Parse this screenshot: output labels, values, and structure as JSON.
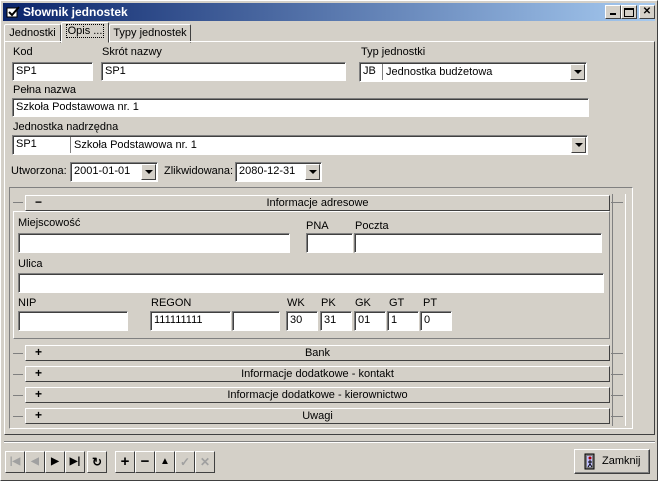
{
  "window": {
    "title": "Słownik jednostek"
  },
  "tabs": [
    {
      "label": "Jednostki",
      "active": false
    },
    {
      "label": "Opis ...",
      "active": true
    },
    {
      "label": "Typy jednostek",
      "active": false
    }
  ],
  "form": {
    "kod_label": "Kod",
    "kod_value": "SP1",
    "skrot_label": "Skrót nazwy",
    "skrot_value": "SP1",
    "typ_label": "Typ jednostki",
    "typ_code": "JB",
    "typ_name": "Jednostka budżetowa",
    "pelna_label": "Pełna nazwa",
    "pelna_value": "Szkoła Podstawowa nr. 1",
    "nadrzedna_label": "Jednostka nadrzędna",
    "nadrzedna_code": "SP1",
    "nadrzedna_name": "Szkoła Podstawowa nr. 1",
    "utworzona_label": "Utworzona:",
    "utworzona_value": "2001-01-01",
    "zlikwidowana_label": "Zlikwidowana:",
    "zlikwidowana_value": "2080-12-31"
  },
  "adres": {
    "header": "Informacje adresowe",
    "toggle": "−",
    "miejscowosc_label": "Miejscowość",
    "miejscowosc_value": "",
    "pna_label": "PNA",
    "pna_value": "",
    "poczta_label": "Poczta",
    "poczta_value": "",
    "ulica_label": "Ulica",
    "ulica_value": "",
    "nip_label": "NIP",
    "nip_value": "",
    "regon_label": "REGON",
    "regon_value": "111111111",
    "regon_ext_value": "",
    "wk_label": "WK",
    "wk_value": "30",
    "pk_label": "PK",
    "pk_value": "31",
    "gk_label": "GK",
    "gk_value": "01",
    "gt_label": "GT",
    "gt_value": "1",
    "pt_label": "PT",
    "pt_value": "0"
  },
  "sections": [
    {
      "label": "Bank",
      "toggle": "+"
    },
    {
      "label": "Informacje dodatkowe - kontakt",
      "toggle": "+"
    },
    {
      "label": "Informacje dodatkowe - kierownictwo",
      "toggle": "+"
    },
    {
      "label": "Uwagi",
      "toggle": "+"
    }
  ],
  "toolbar": {
    "first": "|◀",
    "prev": "◀",
    "next": "▶",
    "last": "▶|",
    "refresh": "↻",
    "add": "+",
    "delete": "−",
    "up": "▲",
    "confirm": "✓",
    "cancel": "✕"
  },
  "close_button": {
    "label": "Zamknij"
  }
}
